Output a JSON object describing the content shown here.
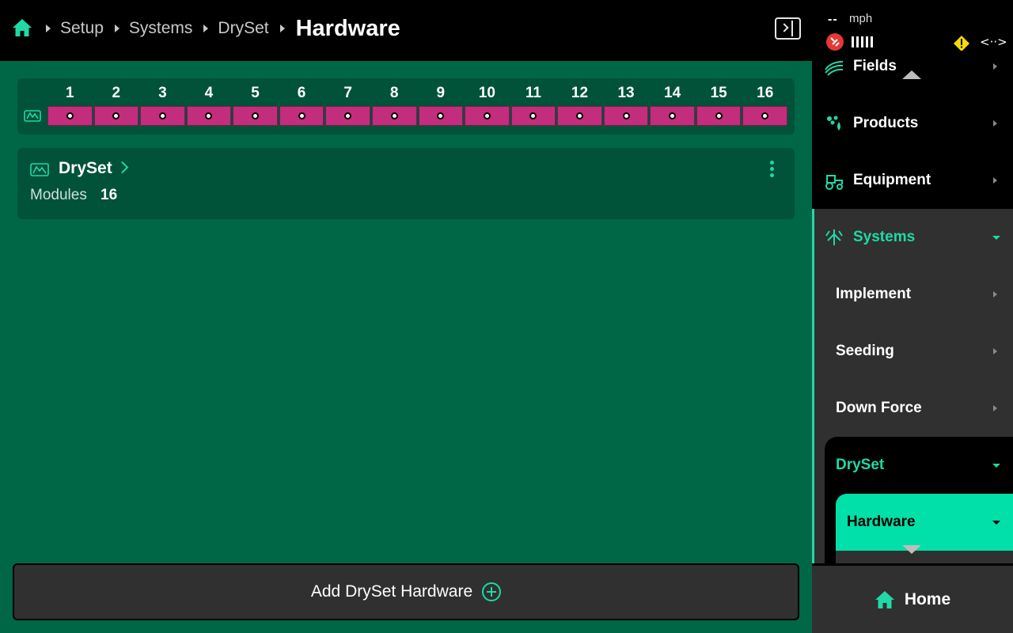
{
  "breadcrumb": {
    "items": [
      "Setup",
      "Systems",
      "DrySet"
    ],
    "current": "Hardware"
  },
  "row_bar": {
    "module_numbers": [
      "1",
      "2",
      "3",
      "4",
      "5",
      "6",
      "7",
      "8",
      "9",
      "10",
      "11",
      "12",
      "13",
      "14",
      "15",
      "16"
    ],
    "segment_color": "#c22d7c"
  },
  "card": {
    "title": "DrySet",
    "modules_label": "Modules",
    "modules_value": "16"
  },
  "add_button": {
    "label": "Add DrySet Hardware"
  },
  "status": {
    "speed_value": "--",
    "speed_unit": "mph"
  },
  "nav": {
    "fields": "Fields",
    "products": "Products",
    "equipment": "Equipment",
    "systems": "Systems",
    "implement": "Implement",
    "seeding": "Seeding",
    "down_force": "Down Force",
    "dryset": "DrySet",
    "hardware": "Hardware"
  },
  "home": {
    "label": "Home"
  },
  "colors": {
    "accent": "#1fd9a6",
    "main_bg": "#006746",
    "selected": "#00e0a8",
    "warning": "#f5d90a"
  }
}
